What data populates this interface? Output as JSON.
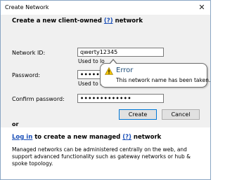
{
  "window": {
    "title": "Create Network"
  },
  "section1": {
    "heading_prefix": "Create a new client-owned",
    "help_mark": "(?)",
    "heading_suffix": "network"
  },
  "fields": {
    "network_id": {
      "label": "Network ID:",
      "value": "qwerty12345",
      "hint": "Used to lo"
    },
    "password": {
      "label": "Password:",
      "value": "••••••",
      "hint": "Used to re"
    },
    "confirm_password": {
      "label": "Confirm password:",
      "value": "•••••••••••••"
    }
  },
  "buttons": {
    "create": "Create",
    "cancel": "Cancel"
  },
  "divider": {
    "or": "or"
  },
  "section2": {
    "login_link": "Log in",
    "line_middle": "to create a new managed",
    "help_mark": "(?)",
    "line_suffix": "network",
    "description": "Managed networks can be administered centrally on the web, and support advanced functionality such as gateway networks or hub & spoke topology."
  },
  "tooltip": {
    "icon": "warning-icon",
    "title": "Error",
    "message": "This network name has been taken."
  },
  "colors": {
    "link": "#1a4fb8",
    "error_title": "#1f4e79",
    "warning": "#f2c200"
  }
}
